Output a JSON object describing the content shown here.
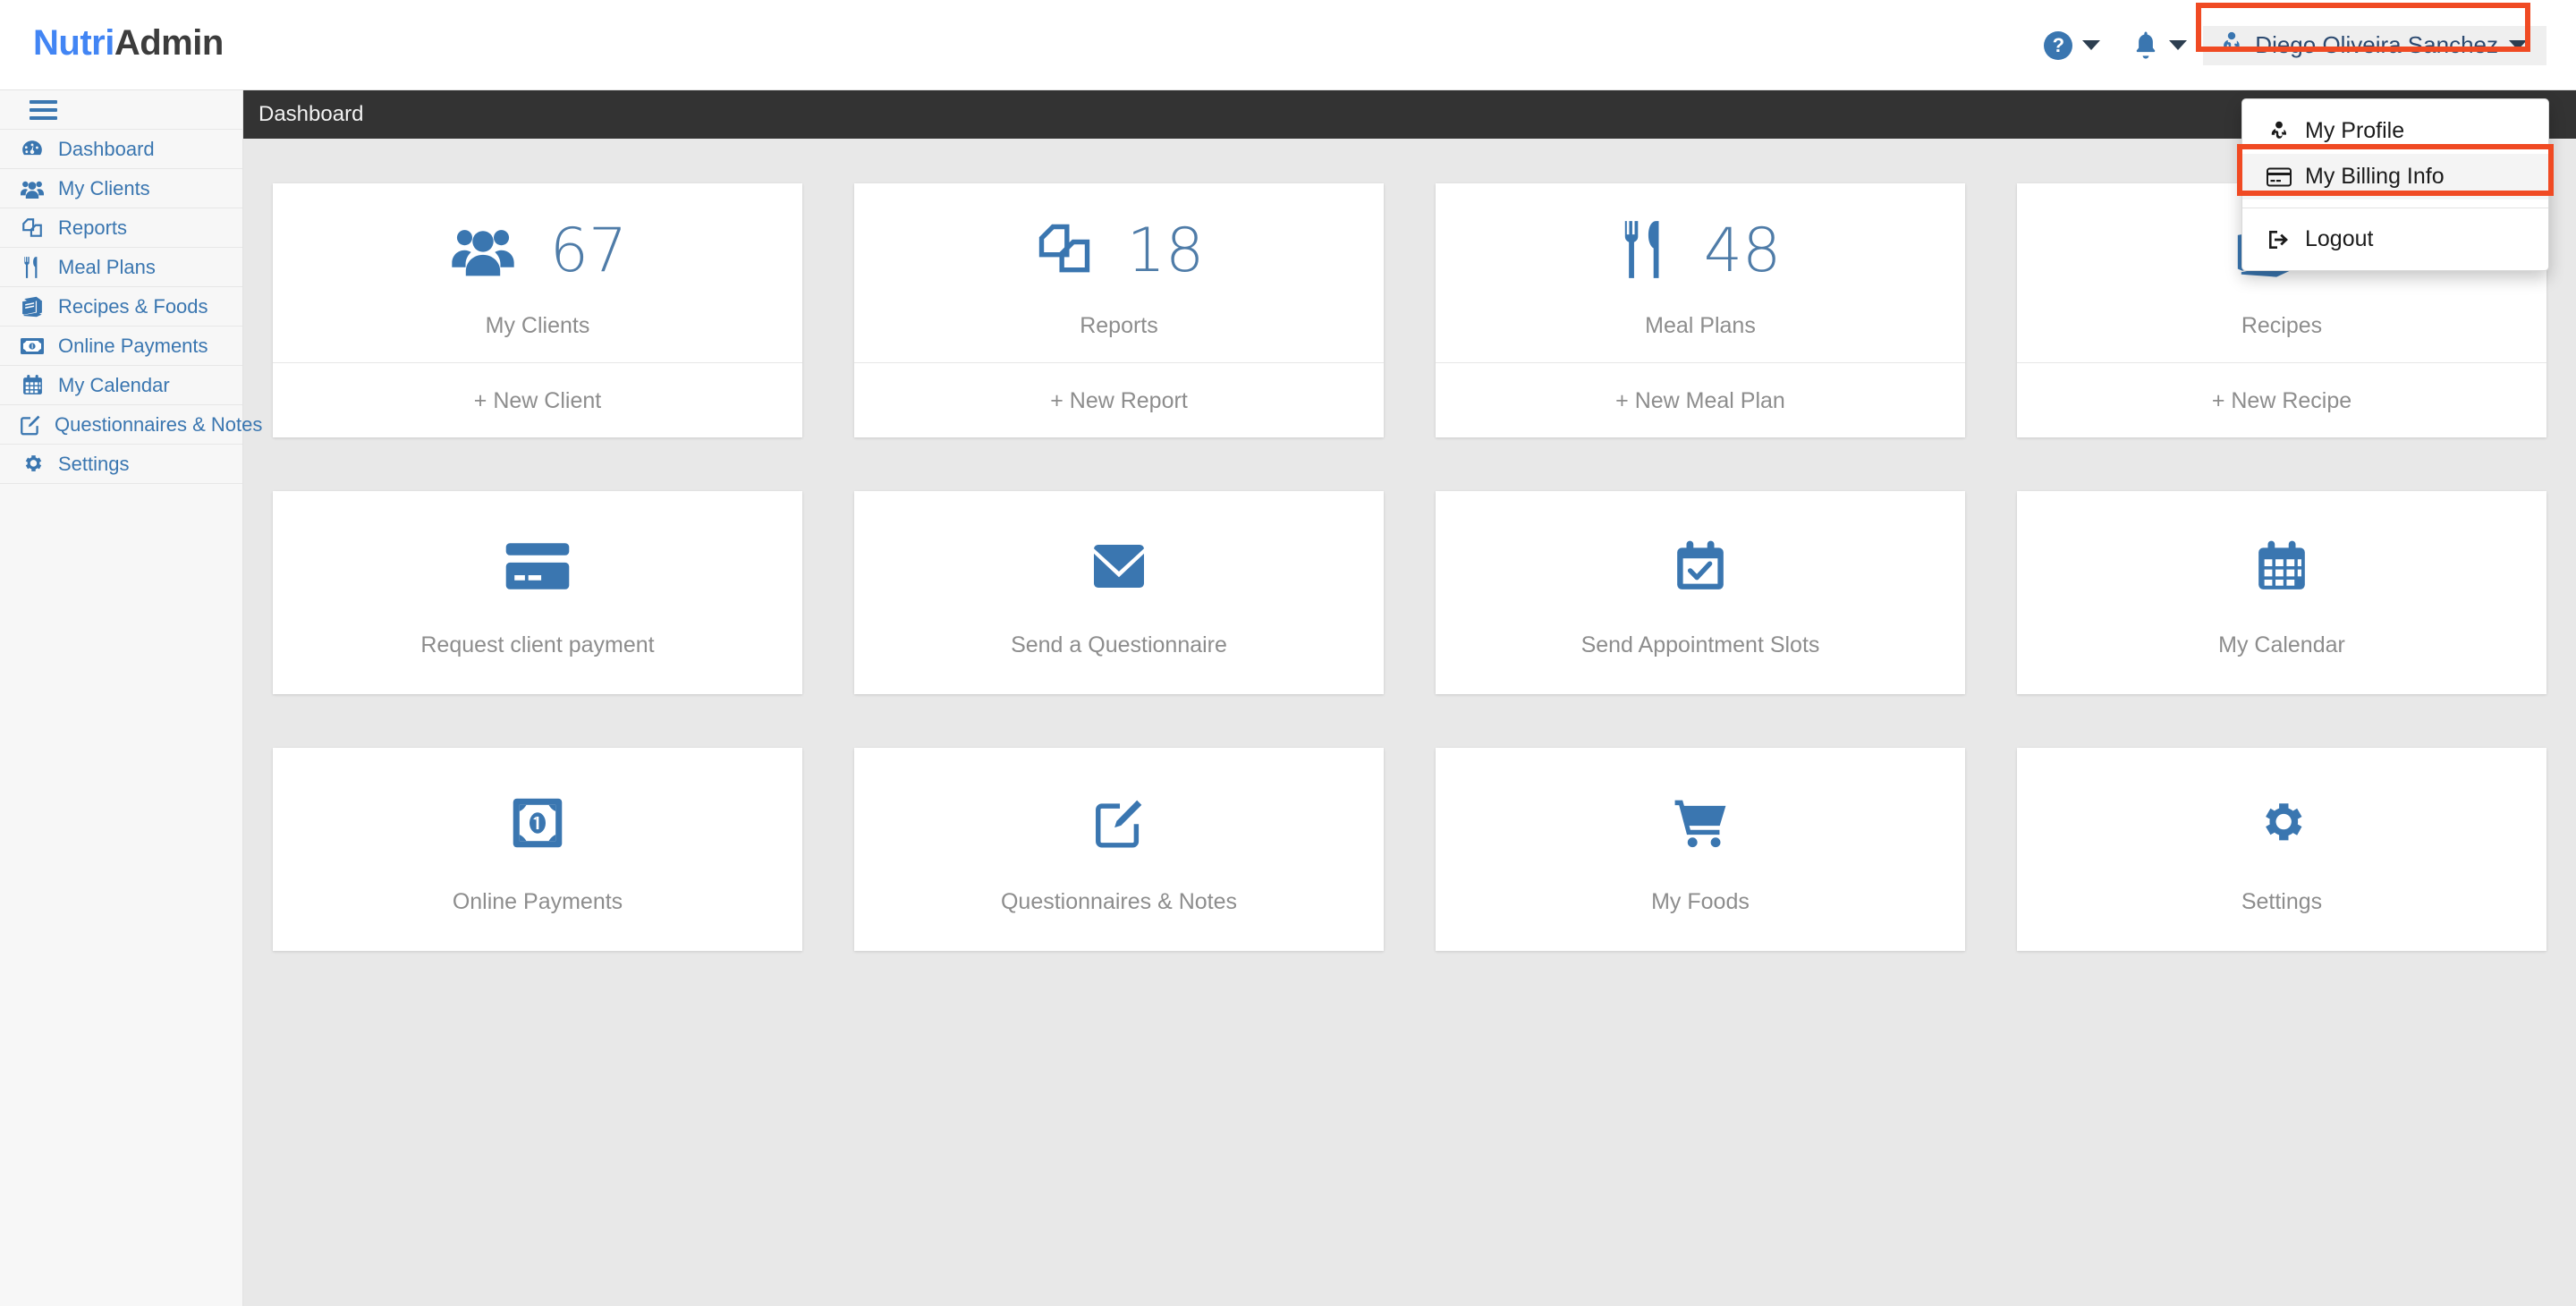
{
  "brand": {
    "part1": "Nutri",
    "part2": "Admin",
    "accent": "#4285f4",
    "dark": "#3c3c3c"
  },
  "header": {
    "help_icon": "question-circle-icon",
    "bell_icon": "bell-icon",
    "user_name": "Diego Oliveira Sanchez",
    "user_icon": "user-md-icon",
    "highlight_color": "#f04a23"
  },
  "user_dropdown": {
    "items": [
      {
        "label": "My Profile",
        "icon": "user-md-icon",
        "active": false
      },
      {
        "label": "My Billing Info",
        "icon": "credit-card-icon",
        "active": true
      },
      {
        "label": "Logout",
        "icon": "sign-out-icon",
        "active": false
      }
    ]
  },
  "sidebar": {
    "toggle_icon": "hamburger-icon",
    "items": [
      {
        "label": "Dashboard",
        "icon": "dashboard-icon"
      },
      {
        "label": "My Clients",
        "icon": "users-icon"
      },
      {
        "label": "Reports",
        "icon": "copy-icon"
      },
      {
        "label": "Meal Plans",
        "icon": "cutlery-icon"
      },
      {
        "label": "Recipes & Foods",
        "icon": "book-icon"
      },
      {
        "label": "Online Payments",
        "icon": "money-icon"
      },
      {
        "label": "My Calendar",
        "icon": "calendar-icon"
      },
      {
        "label": "Questionnaires & Notes",
        "icon": "pen-square-icon"
      },
      {
        "label": "Settings",
        "icon": "gear-icon"
      }
    ]
  },
  "breadcrumb": {
    "title": "Dashboard"
  },
  "stat_cards": [
    {
      "icon": "users-icon",
      "count": "67",
      "label": "My Clients",
      "action": "+ New Client"
    },
    {
      "icon": "copy-icon",
      "count": "18",
      "label": "Reports",
      "action": "+ New Report"
    },
    {
      "icon": "cutlery-icon",
      "count": "48",
      "label": "Meal Plans",
      "action": "+ New Meal Plan"
    },
    {
      "icon": "book-icon",
      "count": "",
      "label": "Recipes",
      "action": "+ New Recipe"
    }
  ],
  "action_cards_row2": [
    {
      "icon": "credit-card-icon",
      "label": "Request client payment"
    },
    {
      "icon": "envelope-icon",
      "label": "Send a Questionnaire"
    },
    {
      "icon": "calendar-check-icon",
      "label": "Send Appointment Slots"
    },
    {
      "icon": "calendar-icon",
      "label": "My Calendar"
    }
  ],
  "action_cards_row3": [
    {
      "icon": "money-icon",
      "label": "Online Payments"
    },
    {
      "icon": "pen-square-icon",
      "label": "Questionnaires & Notes"
    },
    {
      "icon": "shopping-cart-icon",
      "label": "My Foods"
    },
    {
      "icon": "gear-icon",
      "label": "Settings"
    }
  ],
  "colors": {
    "primary_blue": "#3a76b0",
    "sidebar_bg": "#f7f7f7",
    "content_bg": "#e8e8e8",
    "crumb_bg": "#333333"
  }
}
